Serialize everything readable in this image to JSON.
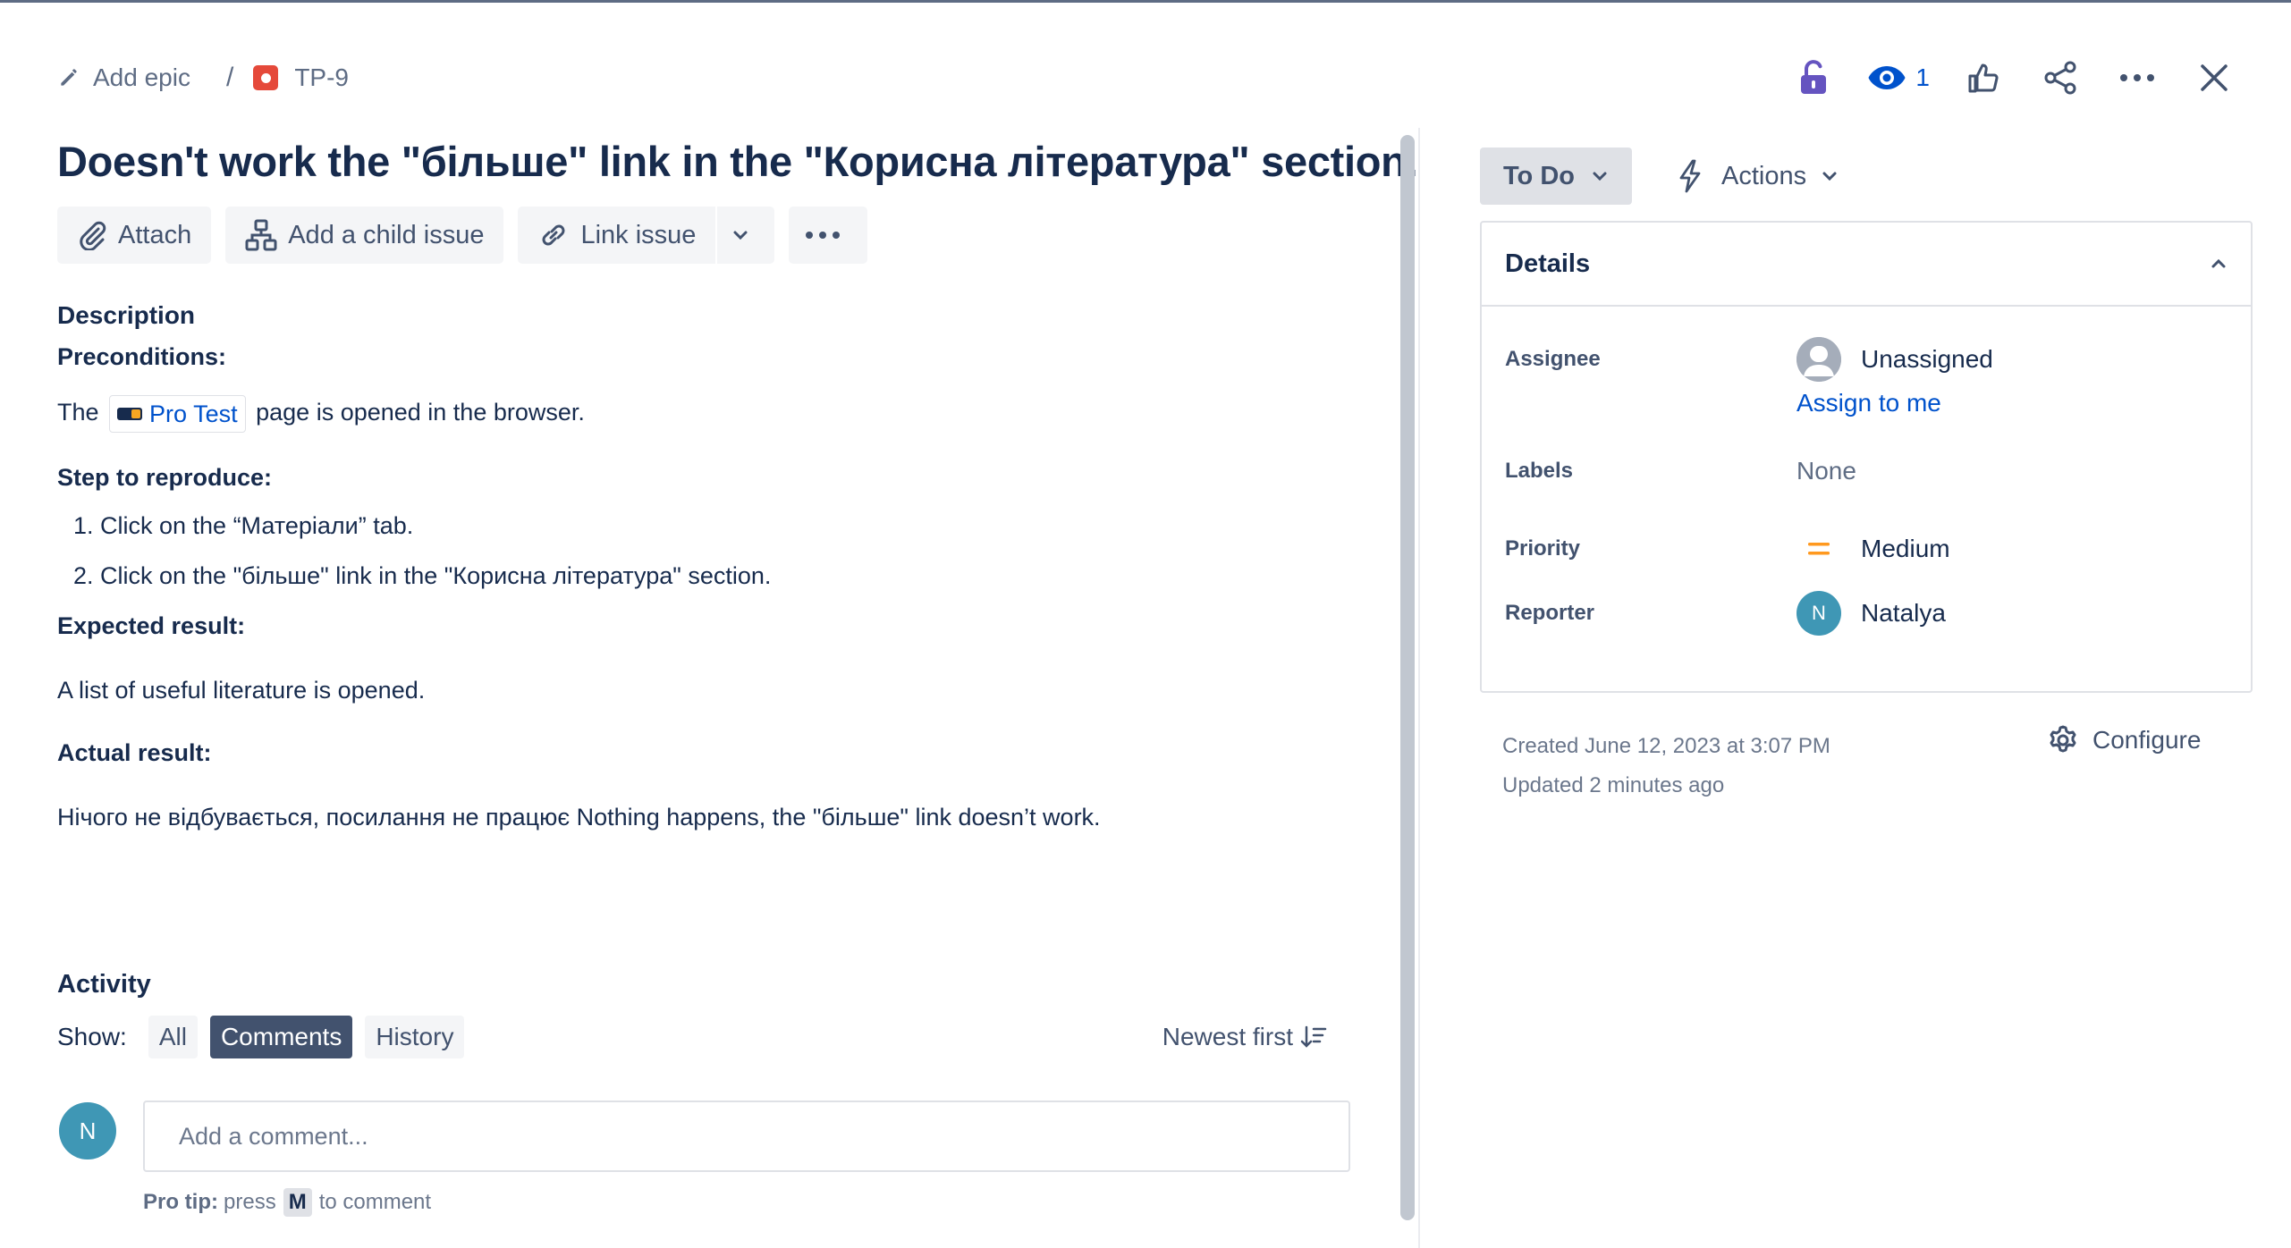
{
  "breadcrumb": {
    "add_epic": "Add epic",
    "separator": "/",
    "issue_key": "TP-9"
  },
  "header": {
    "watch_count": "1"
  },
  "issue": {
    "title": "Doesn't work the \"більше\" link in the \"Корисна література\" section."
  },
  "toolbar": {
    "attach": "Attach",
    "add_child": "Add a child issue",
    "link_issue": "Link issue"
  },
  "description": {
    "heading": "Description",
    "preconditions_h": "Preconditions:",
    "pre_before": "The",
    "pre_link": "Pro Test",
    "pre_after": "page is opened in the browser.",
    "steps_h": "Step to reproduce:",
    "steps": [
      "Click on the “Матеріали” tab.",
      "Click on the \"більше\" link in the \"Корисна література\" section."
    ],
    "expected_h": "Expected result:",
    "expected": "A list of useful literature is opened.",
    "actual_h": "Actual result:",
    "actual": "Нічого не відбувається, посилання не працює Nothing happens, the \"більше\" link doesn’t work."
  },
  "activity": {
    "heading": "Activity",
    "show_label": "Show:",
    "filters": [
      "All",
      "Comments",
      "History"
    ],
    "active_filter": "Comments",
    "sort": "Newest first",
    "avatar_initial": "N",
    "comment_placeholder": "Add a comment...",
    "pro_tip_bold": "Pro tip:",
    "pro_tip_pre": "press",
    "pro_tip_key": "M",
    "pro_tip_post": "to comment"
  },
  "sidebar": {
    "status": "To Do",
    "actions": "Actions",
    "details_heading": "Details",
    "fields": {
      "assignee_label": "Assignee",
      "assignee_value": "Unassigned",
      "assign_to_me": "Assign to me",
      "labels_label": "Labels",
      "labels_value": "None",
      "priority_label": "Priority",
      "priority_value": "Medium",
      "reporter_label": "Reporter",
      "reporter_initial": "N",
      "reporter_value": "Natalya"
    },
    "created": "Created June 12, 2023 at 3:07 PM",
    "updated": "Updated 2 minutes ago",
    "configure": "Configure"
  },
  "colors": {
    "link_blue": "#0052cc",
    "priority_orange": "#ff991f",
    "bug_red": "#e5493a",
    "avatar_teal": "#3f97b5",
    "lock_purple": "#6554c0"
  }
}
